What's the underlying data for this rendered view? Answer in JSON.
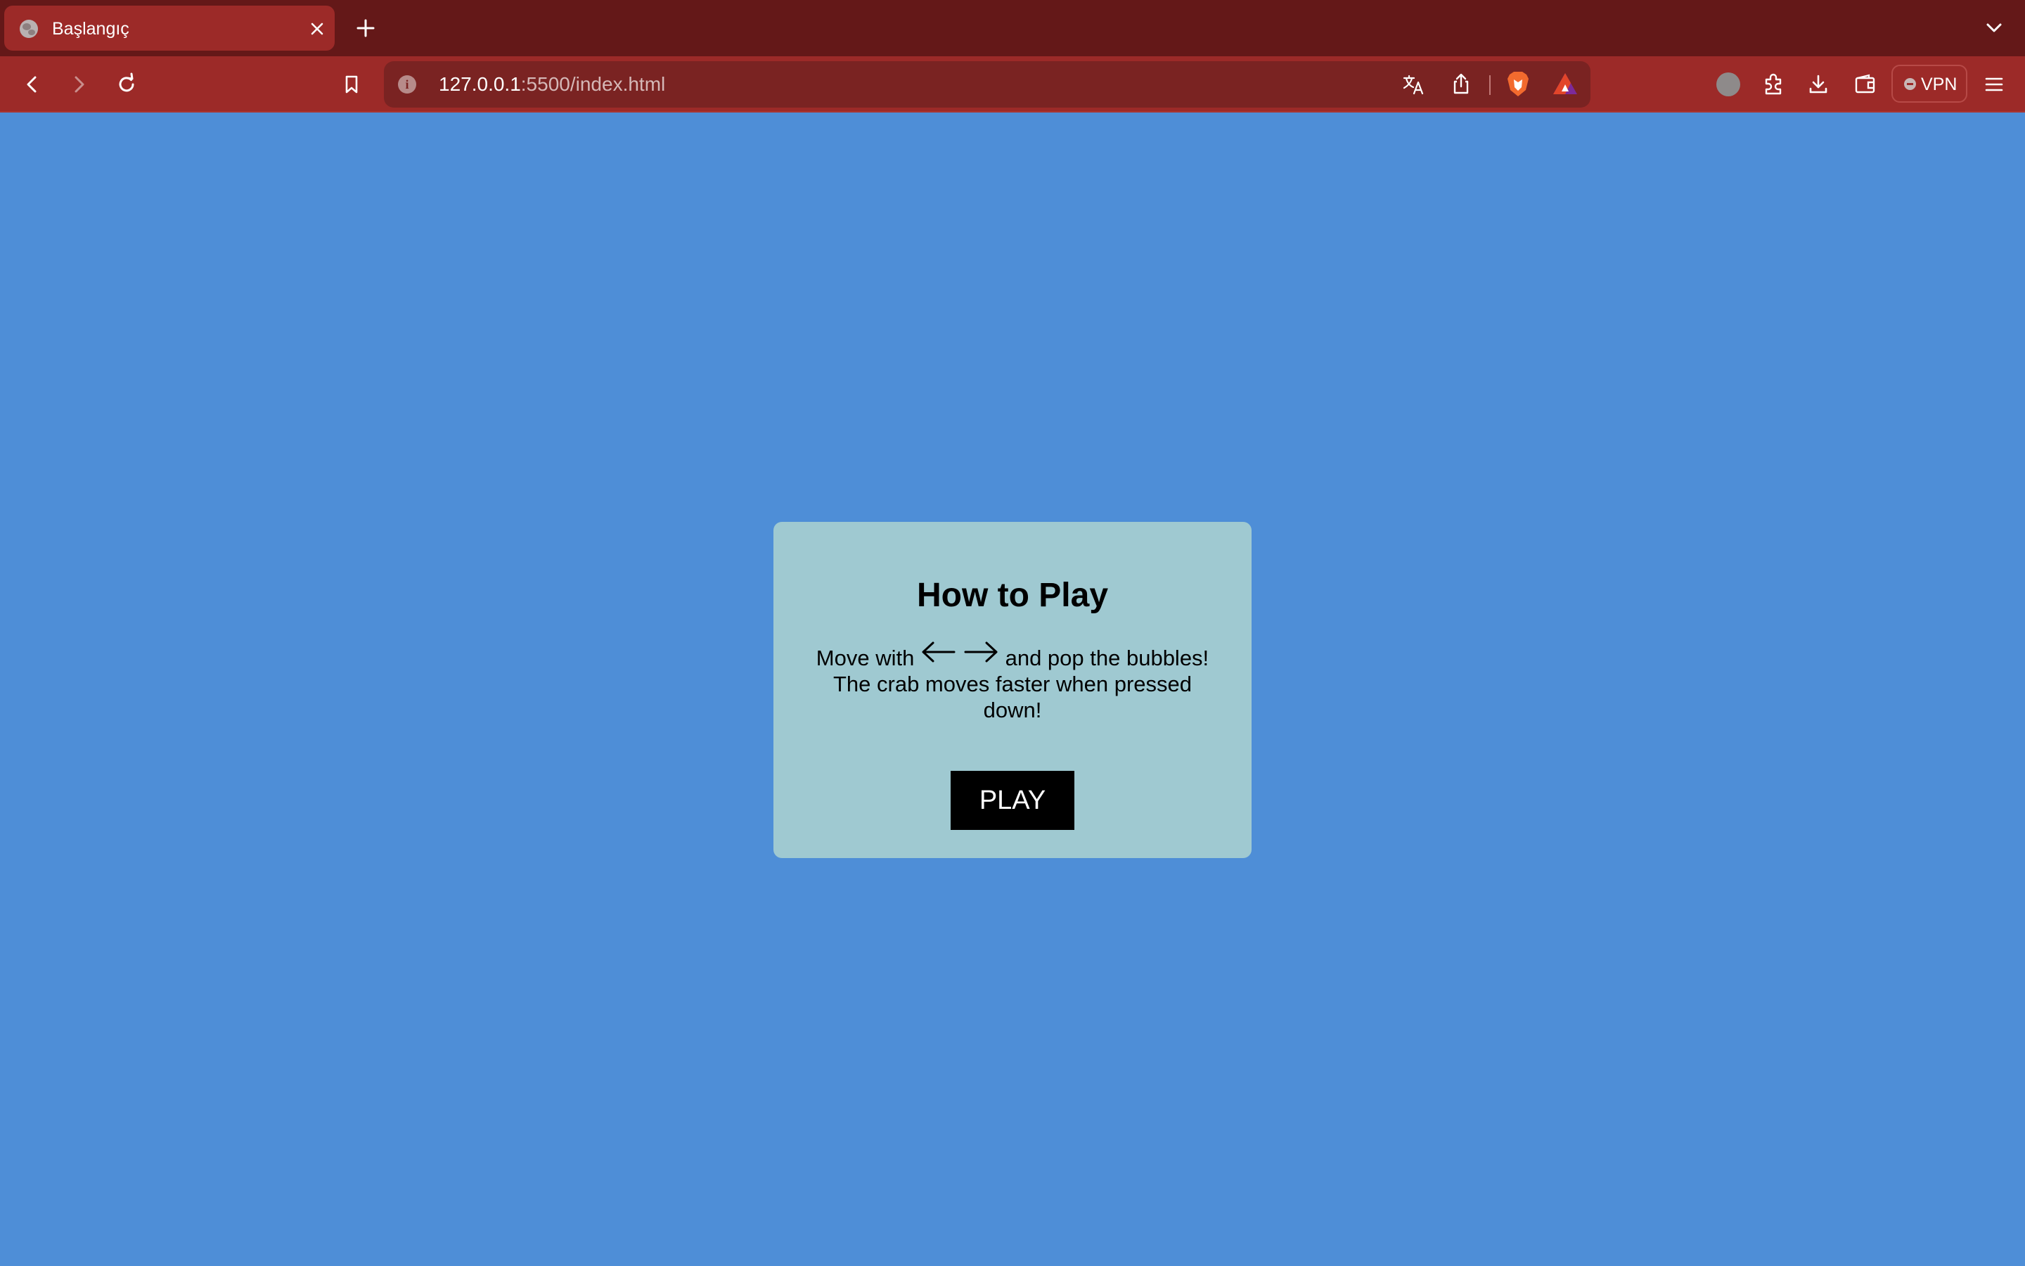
{
  "browser": {
    "tab": {
      "title": "Başlangıç"
    },
    "address_bar": {
      "host": "127.0.0.1",
      "path": ":5500/index.html"
    },
    "vpn_label": "VPN",
    "colors": {
      "tabstrip": "#641818",
      "toolbar": "#9c2a28",
      "urlbar": "#7a2322"
    },
    "icons": [
      "globe-icon",
      "close-icon",
      "plus-icon",
      "chevron-down-icon",
      "back-icon",
      "forward-icon",
      "reload-icon",
      "bookmark-icon",
      "info-icon",
      "translate-icon",
      "share-icon",
      "brave-shields-icon",
      "brave-rewards-icon",
      "speedreader-icon",
      "extensions-icon",
      "download-icon",
      "wallet-icon",
      "menu-icon"
    ]
  },
  "game": {
    "title": "How to Play",
    "instruction_before": "Move with",
    "instruction_after": "and pop the bubbles! The crab moves faster when pressed down!",
    "play_label": "PLAY",
    "colors": {
      "background": "#4e8ed7",
      "card": "#9fc9d1",
      "button": "#000000"
    }
  }
}
